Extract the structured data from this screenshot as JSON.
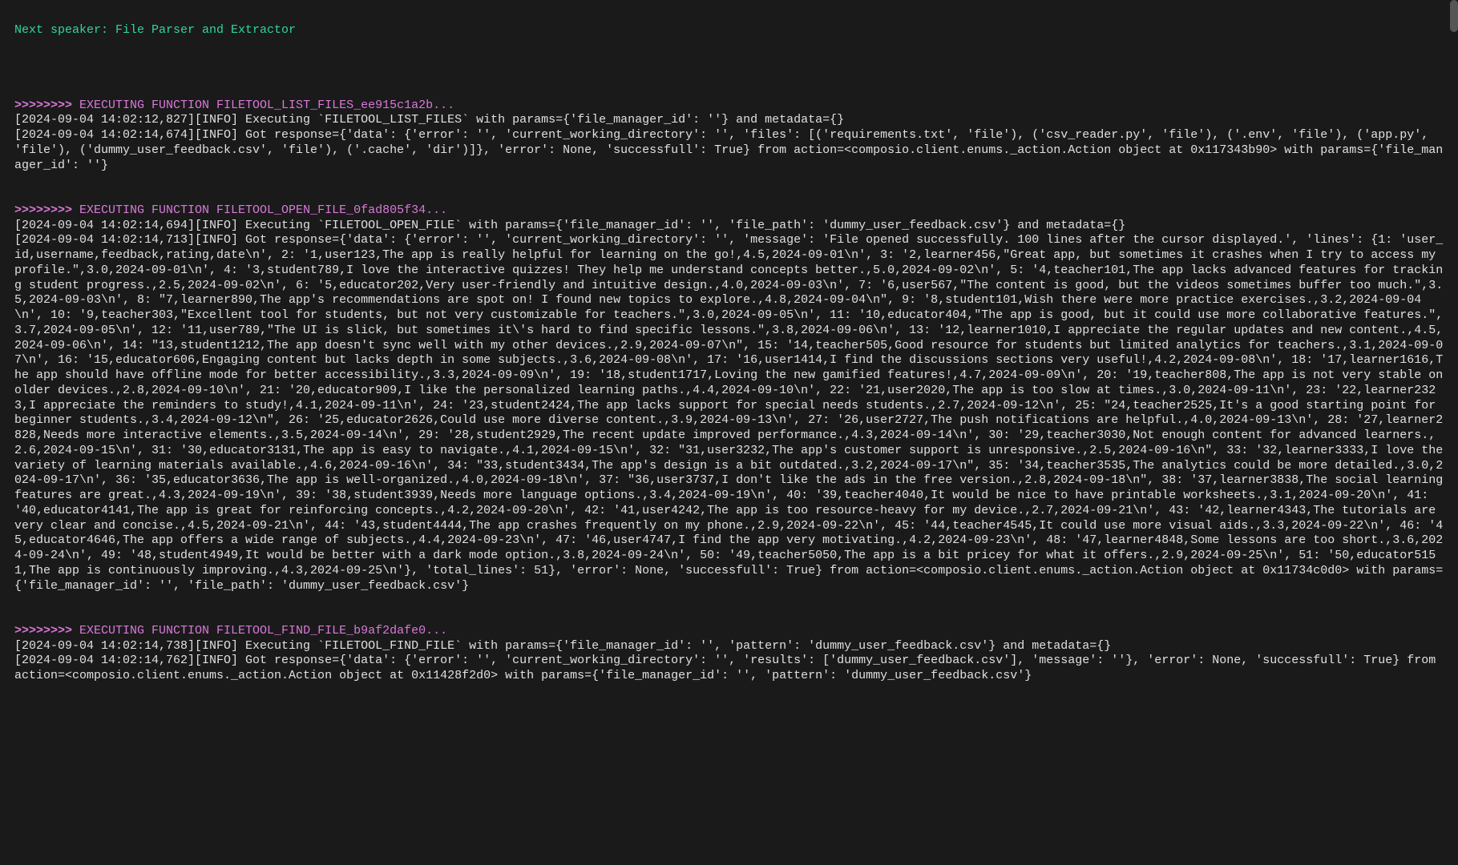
{
  "speaker_line": "Next speaker: File Parser and Extractor",
  "blocks": [
    {
      "header": {
        "chev": ">>>>>>>>",
        "label": " EXECUTING FUNCTION FILETOOL_LIST_FILES_ee915c1a2b..."
      },
      "lines": [
        "[2024-09-04 14:02:12,827][INFO] Executing `FILETOOL_LIST_FILES` with params={'file_manager_id': ''} and metadata={}",
        "[2024-09-04 14:02:14,674][INFO] Got response={'data': {'error': '', 'current_working_directory': '', 'files': [('requirements.txt', 'file'), ('csv_reader.py', 'file'), ('.env', 'file'), ('app.py', 'file'), ('dummy_user_feedback.csv', 'file'), ('.cache', 'dir')]}, 'error': None, 'successfull': True} from action=<composio.client.enums._action.Action object at 0x117343b90> with params={'file_manager_id': ''}"
      ]
    },
    {
      "header": {
        "chev": ">>>>>>>>",
        "label": " EXECUTING FUNCTION FILETOOL_OPEN_FILE_0fad805f34..."
      },
      "lines": [
        "[2024-09-04 14:02:14,694][INFO] Executing `FILETOOL_OPEN_FILE` with params={'file_manager_id': '', 'file_path': 'dummy_user_feedback.csv'} and metadata={}",
        "[2024-09-04 14:02:14,713][INFO] Got response={'data': {'error': '', 'current_working_directory': '', 'message': 'File opened successfully. 100 lines after the cursor displayed.', 'lines': {1: 'user_id,username,feedback,rating,date\\n', 2: '1,user123,The app is really helpful for learning on the go!,4.5,2024-09-01\\n', 3: '2,learner456,\"Great app, but sometimes it crashes when I try to access my profile.\",3.0,2024-09-01\\n', 4: '3,student789,I love the interactive quizzes! They help me understand concepts better.,5.0,2024-09-02\\n', 5: '4,teacher101,The app lacks advanced features for tracking student progress.,2.5,2024-09-02\\n', 6: '5,educator202,Very user-friendly and intuitive design.,4.0,2024-09-03\\n', 7: '6,user567,\"The content is good, but the videos sometimes buffer too much.\",3.5,2024-09-03\\n', 8: \"7,learner890,The app's recommendations are spot on! I found new topics to explore.,4.8,2024-09-04\\n\", 9: '8,student101,Wish there were more practice exercises.,3.2,2024-09-04\\n', 10: '9,teacher303,\"Excellent tool for students, but not very customizable for teachers.\",3.0,2024-09-05\\n', 11: '10,educator404,\"The app is good, but it could use more collaborative features.\",3.7,2024-09-05\\n', 12: '11,user789,\"The UI is slick, but sometimes it\\'s hard to find specific lessons.\",3.8,2024-09-06\\n', 13: '12,learner1010,I appreciate the regular updates and new content.,4.5,2024-09-06\\n', 14: \"13,student1212,The app doesn't sync well with my other devices.,2.9,2024-09-07\\n\", 15: '14,teacher505,Good resource for students but limited analytics for teachers.,3.1,2024-09-07\\n', 16: '15,educator606,Engaging content but lacks depth in some subjects.,3.6,2024-09-08\\n', 17: '16,user1414,I find the discussions sections very useful!,4.2,2024-09-08\\n', 18: '17,learner1616,The app should have offline mode for better accessibility.,3.3,2024-09-09\\n', 19: '18,student1717,Loving the new gamified features!,4.7,2024-09-09\\n', 20: '19,teacher808,The app is not very stable on older devices.,2.8,2024-09-10\\n', 21: '20,educator909,I like the personalized learning paths.,4.4,2024-09-10\\n', 22: '21,user2020,The app is too slow at times.,3.0,2024-09-11\\n', 23: '22,learner2323,I appreciate the reminders to study!,4.1,2024-09-11\\n', 24: '23,student2424,The app lacks support for special needs students.,2.7,2024-09-12\\n', 25: \"24,teacher2525,It's a good starting point for beginner students.,3.4,2024-09-12\\n\", 26: '25,educator2626,Could use more diverse content.,3.9,2024-09-13\\n', 27: '26,user2727,The push notifications are helpful.,4.0,2024-09-13\\n', 28: '27,learner2828,Needs more interactive elements.,3.5,2024-09-14\\n', 29: '28,student2929,The recent update improved performance.,4.3,2024-09-14\\n', 30: '29,teacher3030,Not enough content for advanced learners.,2.6,2024-09-15\\n', 31: '30,educator3131,The app is easy to navigate.,4.1,2024-09-15\\n', 32: \"31,user3232,The app's customer support is unresponsive.,2.5,2024-09-16\\n\", 33: '32,learner3333,I love the variety of learning materials available.,4.6,2024-09-16\\n', 34: \"33,student3434,The app's design is a bit outdated.,3.2,2024-09-17\\n\", 35: '34,teacher3535,The analytics could be more detailed.,3.0,2024-09-17\\n', 36: '35,educator3636,The app is well-organized.,4.0,2024-09-18\\n', 37: \"36,user3737,I don't like the ads in the free version.,2.8,2024-09-18\\n\", 38: '37,learner3838,The social learning features are great.,4.3,2024-09-19\\n', 39: '38,student3939,Needs more language options.,3.4,2024-09-19\\n', 40: '39,teacher4040,It would be nice to have printable worksheets.,3.1,2024-09-20\\n', 41: '40,educator4141,The app is great for reinforcing concepts.,4.2,2024-09-20\\n', 42: '41,user4242,The app is too resource-heavy for my device.,2.7,2024-09-21\\n', 43: '42,learner4343,The tutorials are very clear and concise.,4.5,2024-09-21\\n', 44: '43,student4444,The app crashes frequently on my phone.,2.9,2024-09-22\\n', 45: '44,teacher4545,It could use more visual aids.,3.3,2024-09-22\\n', 46: '45,educator4646,The app offers a wide range of subjects.,4.4,2024-09-23\\n', 47: '46,user4747,I find the app very motivating.,4.2,2024-09-23\\n', 48: '47,learner4848,Some lessons are too short.,3.6,2024-09-24\\n', 49: '48,student4949,It would be better with a dark mode option.,3.8,2024-09-24\\n', 50: '49,teacher5050,The app is a bit pricey for what it offers.,2.9,2024-09-25\\n', 51: '50,educator5151,The app is continuously improving.,4.3,2024-09-25\\n'}, 'total_lines': 51}, 'error': None, 'successfull': True} from action=<composio.client.enums._action.Action object at 0x11734c0d0> with params={'file_manager_id': '', 'file_path': 'dummy_user_feedback.csv'}"
      ]
    },
    {
      "header": {
        "chev": ">>>>>>>>",
        "label": " EXECUTING FUNCTION FILETOOL_FIND_FILE_b9af2dafe0..."
      },
      "lines": [
        "[2024-09-04 14:02:14,738][INFO] Executing `FILETOOL_FIND_FILE` with params={'file_manager_id': '', 'pattern': 'dummy_user_feedback.csv'} and metadata={}",
        "[2024-09-04 14:02:14,762][INFO] Got response={'data': {'error': '', 'current_working_directory': '', 'results': ['dummy_user_feedback.csv'], 'message': ''}, 'error': None, 'successfull': True} from action=<composio.client.enums._action.Action object at 0x11428f2d0> with params={'file_manager_id': '', 'pattern': 'dummy_user_feedback.csv'}"
      ]
    }
  ]
}
